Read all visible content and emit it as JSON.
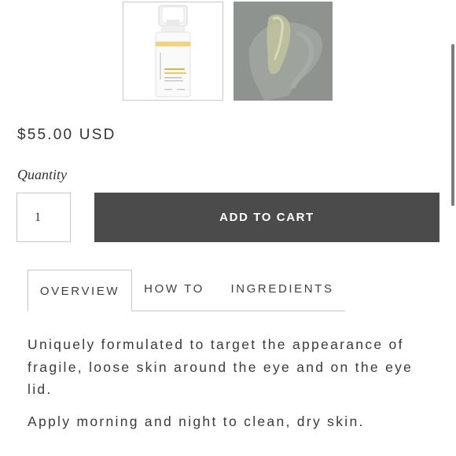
{
  "gallery": {
    "thumbnails": [
      {
        "alt": "product-bottle-thumbnail",
        "icon": "serum-bottle-image"
      },
      {
        "alt": "product-texture-thumbnail",
        "icon": "cream-swatch-image"
      }
    ]
  },
  "product": {
    "price": "$55.00 USD"
  },
  "quantity": {
    "label": "Quantity",
    "value": "1"
  },
  "cart": {
    "add_label": "ADD TO CART"
  },
  "tabs": [
    {
      "label": "OVERVIEW",
      "active": true
    },
    {
      "label": "HOW TO",
      "active": false
    },
    {
      "label": "INGREDIENTS",
      "active": false
    }
  ],
  "overview": {
    "description": "Uniquely formulated to target the appearance of fragile, loose skin around the eye and on the eye lid.",
    "directions": "Apply morning and night to clean, dry skin."
  },
  "colors": {
    "button": "#4b4b4b",
    "text": "#3b3b3b",
    "border": "#c6c6c6",
    "accent_yellow": "#f2d27a"
  }
}
